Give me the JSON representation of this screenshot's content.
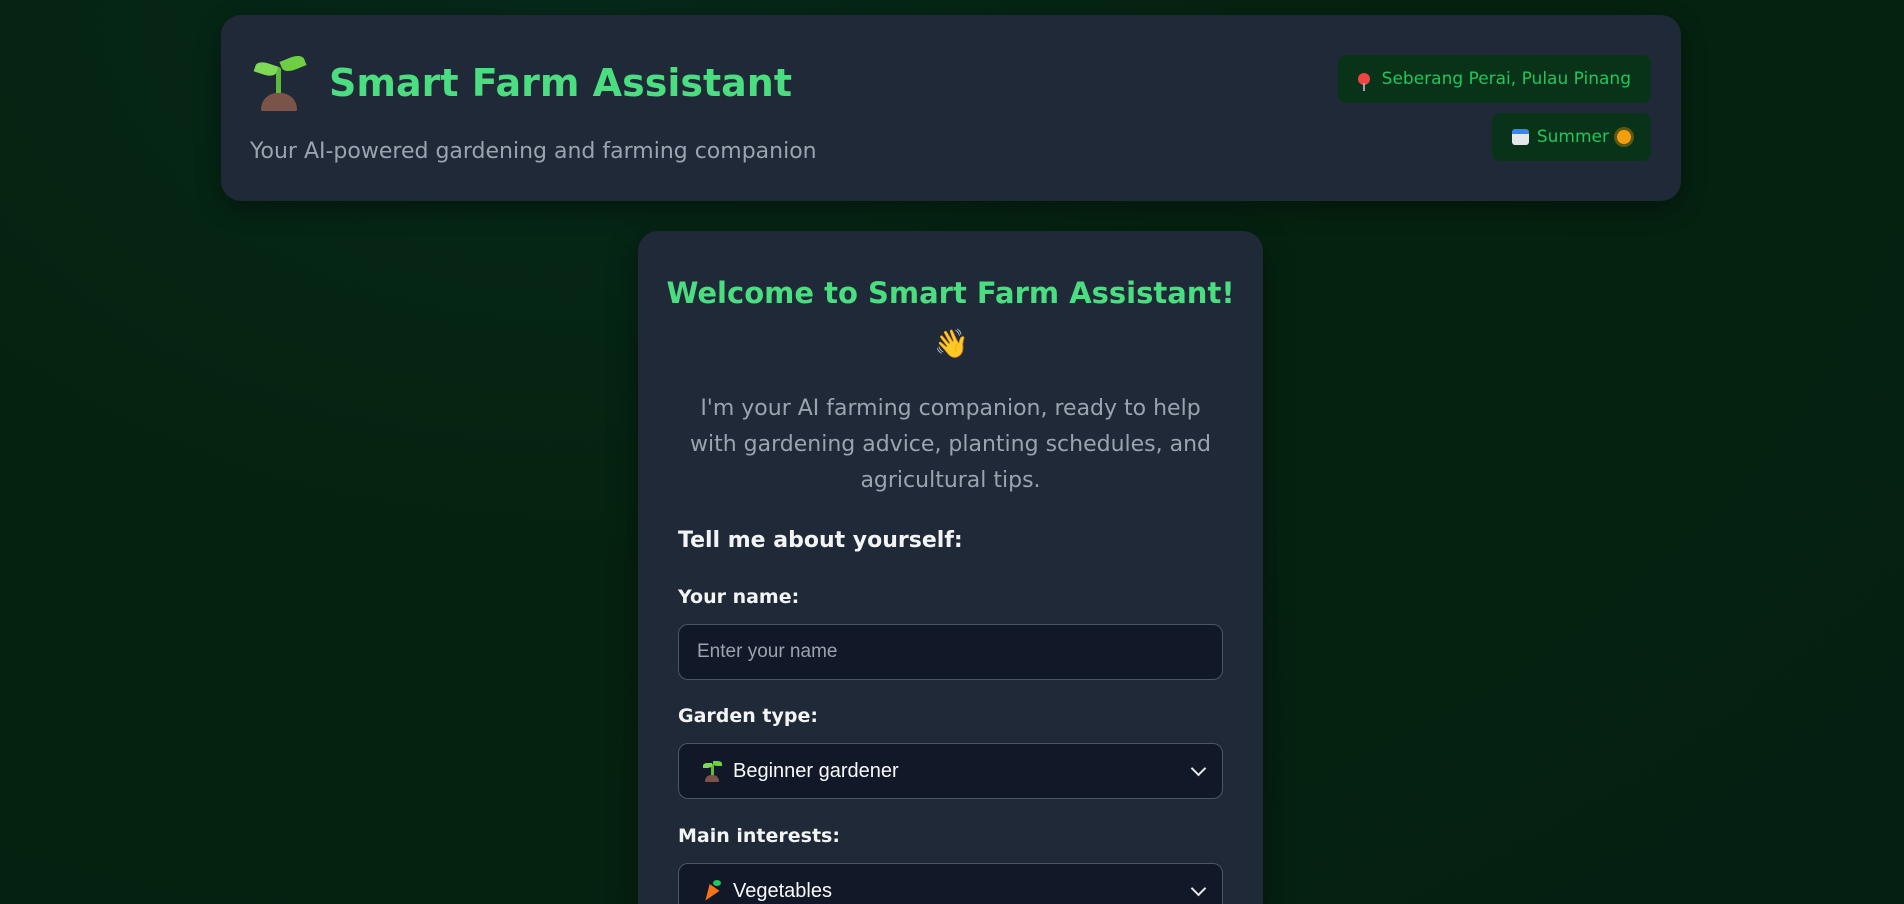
{
  "header": {
    "title": "Smart Farm Assistant",
    "subtitle": "Your AI-powered gardening and farming companion",
    "location": "Seberang Perai, Pulau Pinang",
    "season": "Summer"
  },
  "welcome": {
    "title": "Welcome to Smart Farm Assistant!",
    "intro": "I'm your AI farming companion, ready to help with gardening advice, planting schedules, and agricultural tips.",
    "section_title": "Tell me about yourself:"
  },
  "form": {
    "name_label": "Your name:",
    "name_placeholder": "Enter your name",
    "name_value": "",
    "garden_label": "Garden type:",
    "garden_value": "Beginner gardener",
    "interests_label": "Main interests:",
    "interests_value": "Vegetables"
  },
  "icons": {
    "brand": "seedling-icon",
    "location": "pin-icon",
    "season_calendar": "calendar-icon",
    "season_sun": "sun-icon",
    "wave": "waving-hand-icon",
    "garden_option": "seedling-icon",
    "interests_option": "carrot-icon"
  },
  "colors": {
    "accent": "#4ade80",
    "badge_bg": "#083318",
    "badge_text": "#22c55e",
    "card_bg": "#1f2937",
    "input_bg": "#111827"
  }
}
